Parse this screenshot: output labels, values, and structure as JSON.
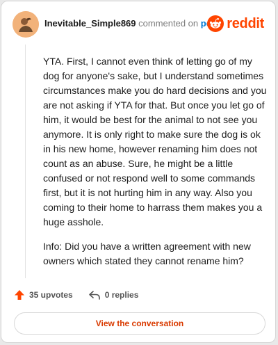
{
  "header": {
    "username": "Inevitable_Simple869",
    "action_text": "commented on",
    "post_link": "post",
    "brand": "reddit"
  },
  "comment": {
    "paragraphs": [
      "YTA. First, I cannot even think of letting go of my dog for anyone's sake, but I understand sometimes circumstances make you do hard decisions and you are not asking if YTA for that. But once you let go of him, it would be best for the animal to not see you anymore. It is only right to make sure the dog is ok in his new home, however renaming him does not count as an abuse. Sure, he might be a little confused or not respond well to some commands first, but it is not hurting him in any way. Also you coming to their home to harrass them makes you a huge asshole.",
      "Info: Did you have a written agreement with new owners which stated they cannot rename him?"
    ]
  },
  "footer": {
    "upvotes": "35 upvotes",
    "replies": "0 replies",
    "cta": "View the conversation"
  },
  "colors": {
    "brand": "#ff4500",
    "link": "#0079d3",
    "cta": "#d93a00"
  },
  "icons": {
    "avatar": "user-avatar",
    "brand": "reddit-snoo-icon",
    "upvote": "upvote-arrow-icon",
    "reply": "reply-arrow-icon"
  }
}
